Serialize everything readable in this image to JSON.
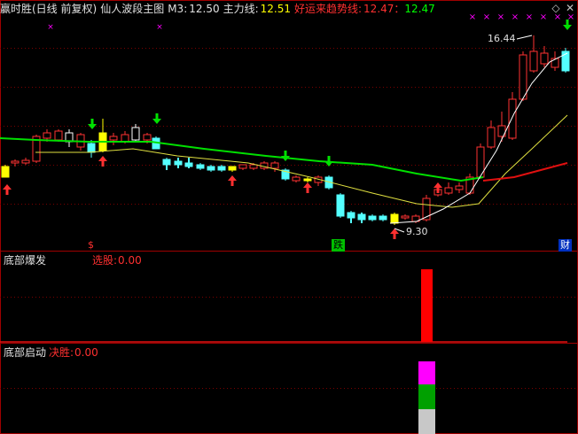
{
  "header": {
    "title": "赢时胜(日线 前复权)",
    "indicator_name": "仙人波段主图",
    "m3_label": "M3:",
    "m3_value": "12.50",
    "main_line_label": "主力线:",
    "main_line_value": "12.51",
    "trend_label": "好运来趋势线:",
    "trend_value1": "12.47",
    "trend_sep": "：",
    "trend_value2": "12.47"
  },
  "controls": {
    "diamond": "◇",
    "close": "✕"
  },
  "annotations": {
    "high_price": "16.44",
    "low_price": "9.30",
    "badge_dollar": "$",
    "badge_fall": "跌",
    "badge_finance": "财"
  },
  "panel2": {
    "title": "底部爆发",
    "label": "选股:",
    "value": "0.00"
  },
  "panel3": {
    "title": "底部启动",
    "label": "决胜:",
    "value": "0.00"
  },
  "colors": {
    "up": "#ff3232",
    "down": "#54ffff",
    "gold": "#ffff00",
    "green_line": "#00e000",
    "red_line": "#e01010",
    "yellow_line": "#e0e040",
    "white_line": "#ffffff",
    "magenta": "#ff00ff",
    "green_block": "#00a000",
    "silver": "#c8c8c8"
  }
}
